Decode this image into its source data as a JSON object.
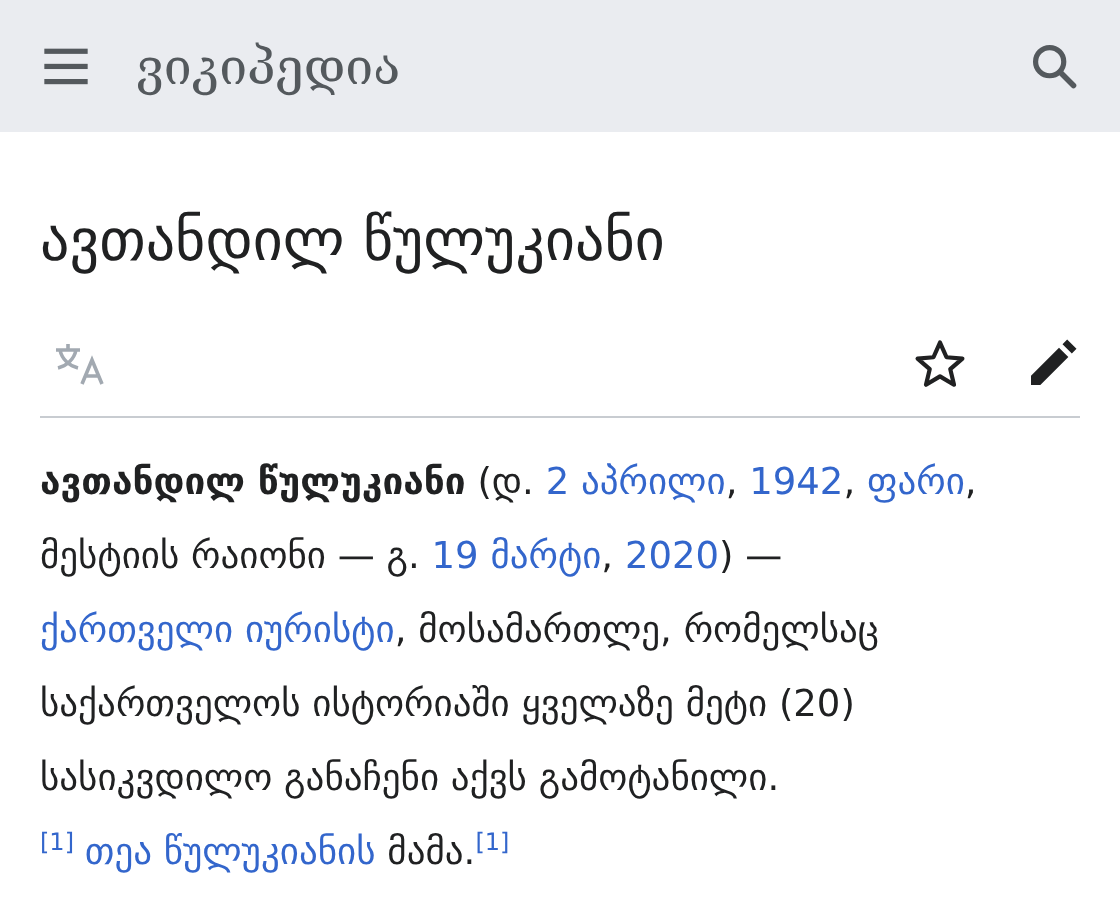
{
  "header": {
    "site_name": "ვიკიპედია"
  },
  "title": "ავთანდილ წულუკიანი",
  "toolbar": [
    {
      "kind": "language"
    },
    {
      "kind": "watch",
      "selected": false
    },
    {
      "kind": "edit"
    }
  ],
  "paragraph": [
    {
      "kind": "bold",
      "text": "ავთანდილ წულუკიანი"
    },
    {
      "kind": "text",
      "text": " (დ. "
    },
    {
      "kind": "link",
      "text": "2 აპრილი"
    },
    {
      "kind": "text",
      "text": ", "
    },
    {
      "kind": "link",
      "text": "1942"
    },
    {
      "kind": "text",
      "text": ", "
    },
    {
      "kind": "link",
      "text": "ფარი"
    },
    {
      "kind": "text",
      "text": ", მესტიის რაიონი — გ. "
    },
    {
      "kind": "link",
      "text": "19 მარტი"
    },
    {
      "kind": "text",
      "text": ", "
    },
    {
      "kind": "link",
      "text": "2020"
    },
    {
      "kind": "text",
      "text": ") — "
    },
    {
      "kind": "link",
      "text": "ქართველი იურისტი"
    },
    {
      "kind": "text",
      "text": ", მოსამართლე, რომელსაც საქართველოს ისტორიაში ყველაზე მეტი (20) სასიკვდილო განაჩენი აქვს გამოტანილი."
    },
    {
      "kind": "ref",
      "text": "[1]"
    },
    {
      "kind": "link",
      "text": "თეა წულუკიანის"
    },
    {
      "kind": "text",
      "text": " მამა."
    },
    {
      "kind": "ref",
      "text": "[1]"
    }
  ]
}
